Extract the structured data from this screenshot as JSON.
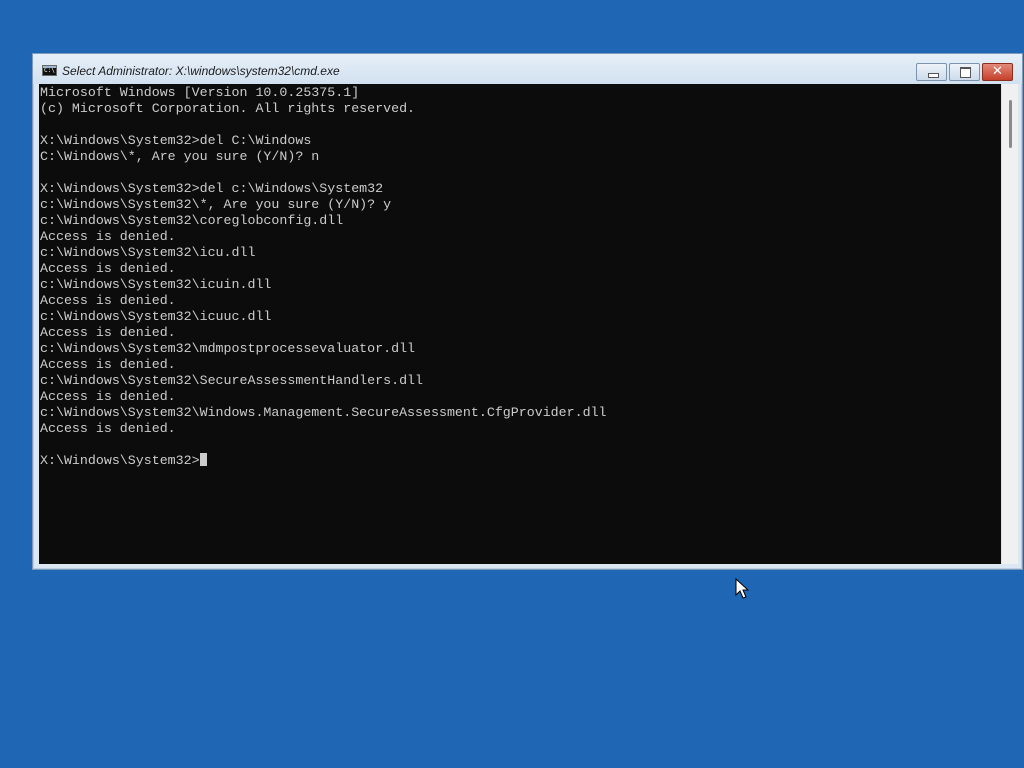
{
  "window": {
    "title": "Select Administrator: X:\\windows\\system32\\cmd.exe",
    "icon_text": "C:\\",
    "controls": {
      "minimize_icon": "minimize-icon",
      "restore_icon": "restore-icon",
      "close_label": "✕"
    }
  },
  "console": {
    "lines": [
      "Microsoft Windows [Version 10.0.25375.1]",
      "(c) Microsoft Corporation. All rights reserved.",
      "",
      "X:\\Windows\\System32>del C:\\Windows",
      "C:\\Windows\\*, Are you sure (Y/N)? n",
      "",
      "X:\\Windows\\System32>del c:\\Windows\\System32",
      "c:\\Windows\\System32\\*, Are you sure (Y/N)? y",
      "c:\\Windows\\System32\\coreglobconfig.dll",
      "Access is denied.",
      "c:\\Windows\\System32\\icu.dll",
      "Access is denied.",
      "c:\\Windows\\System32\\icuin.dll",
      "Access is denied.",
      "c:\\Windows\\System32\\icuuc.dll",
      "Access is denied.",
      "c:\\Windows\\System32\\mdmpostprocessevaluator.dll",
      "Access is denied.",
      "c:\\Windows\\System32\\SecureAssessmentHandlers.dll",
      "Access is denied.",
      "c:\\Windows\\System32\\Windows.Management.SecureAssessment.CfgProvider.dll",
      "Access is denied.",
      ""
    ],
    "prompt": "X:\\Windows\\System32>"
  },
  "colors": {
    "desktop": "#1f66b5",
    "console_bg": "#0c0c0c",
    "console_fg": "#cccccc"
  }
}
